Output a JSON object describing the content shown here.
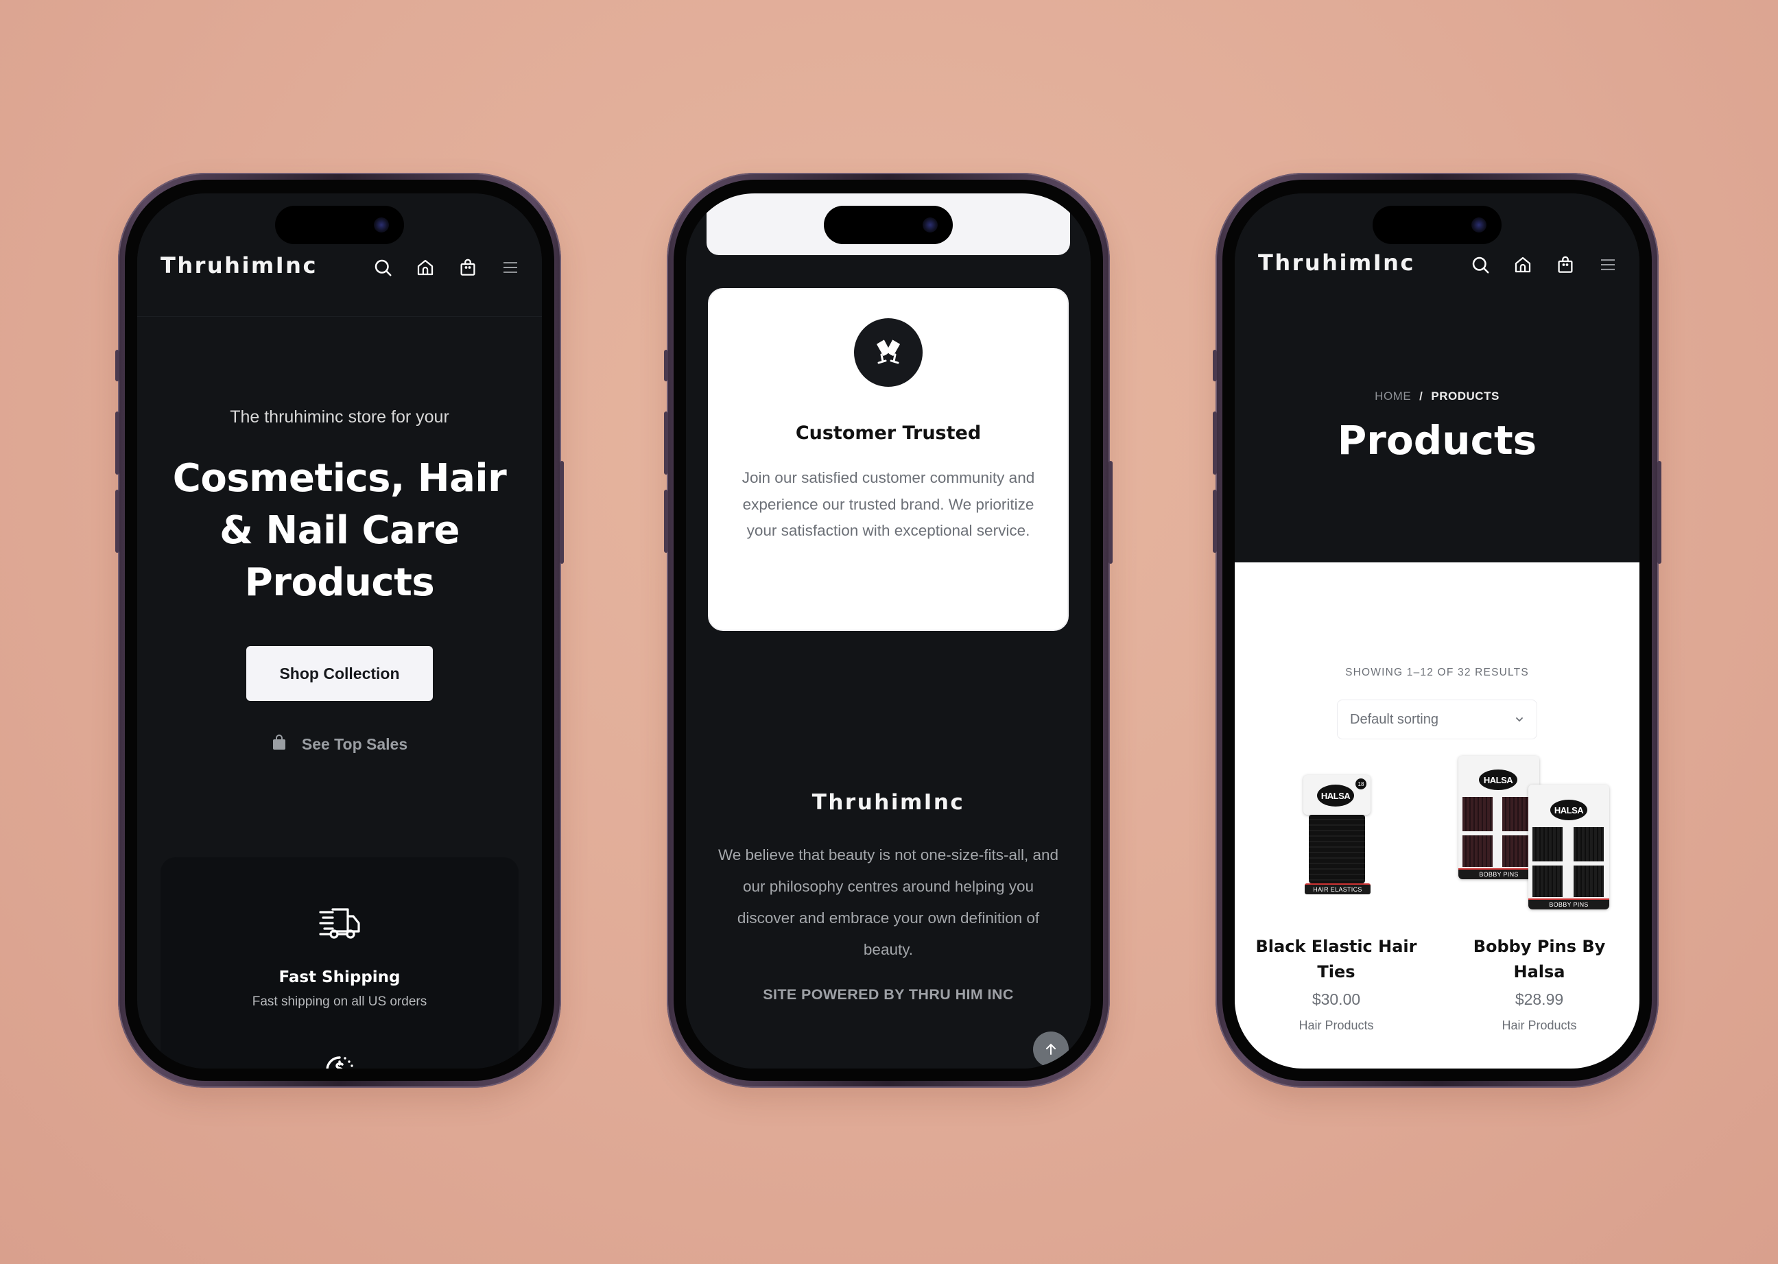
{
  "colors": {
    "background": "#e3b09c",
    "dark_surface": "#121417",
    "light_surface": "#ffffff",
    "muted_text": "#6c7077",
    "button_light": "#f4f4f8"
  },
  "phones": [
    {
      "header": {
        "brand": "ThruhimInc",
        "icons": [
          "search-icon",
          "home-icon",
          "shopping-bag-icon",
          "menu-icon"
        ]
      },
      "hero": {
        "subtitle": "The thruhiminc store for your",
        "title": "Cosmetics, Hair & Nail Care Products",
        "primary_button": "Shop Collection",
        "secondary_link": "See Top Sales",
        "secondary_icon": "shopping-bag-icon"
      },
      "feature": {
        "icon": "delivery-truck-icon",
        "title": "Fast Shipping",
        "description": "Fast shipping on all US orders",
        "next_icon": "coin-clock-icon"
      }
    },
    {
      "trust_card": {
        "icon": "toast-glasses-icon",
        "title": "Customer Trusted",
        "description": "Join our satisfied customer community and experience our trusted brand. We prioritize your satisfaction with exceptional service."
      },
      "footer": {
        "brand": "ThruhimInc",
        "description": "We believe that beauty is not one-size-fits-all, and our philosophy centres around helping you discover and embrace your own definition of beauty.",
        "powered_by": "SITE POWERED BY THRU HIM INC",
        "scroll_top_icon": "arrow-up-icon"
      }
    },
    {
      "header": {
        "brand": "ThruhimInc",
        "icons": [
          "search-icon",
          "home-icon",
          "shopping-bag-icon",
          "menu-icon"
        ]
      },
      "page_hero": {
        "breadcrumb": [
          {
            "label": "HOME"
          },
          {
            "label": "/"
          },
          {
            "label": "PRODUCTS"
          }
        ],
        "title": "Products"
      },
      "shop": {
        "results_count": "SHOWING 1–12 OF 32 RESULTS",
        "sort": {
          "selected": "Default sorting"
        },
        "products": [
          {
            "name": "Black Elastic Hair Ties",
            "price": "$30.00",
            "category": "Hair Products",
            "image": {
              "brand": "HALSA",
              "label": "HAIR ELASTICS",
              "count": "18"
            }
          },
          {
            "name": "Bobby Pins By Halsa",
            "price": "$28.99",
            "category": "Hair Products",
            "image": {
              "brand": "HALSA",
              "label": "BOBBY PINS"
            }
          }
        ]
      }
    }
  ]
}
